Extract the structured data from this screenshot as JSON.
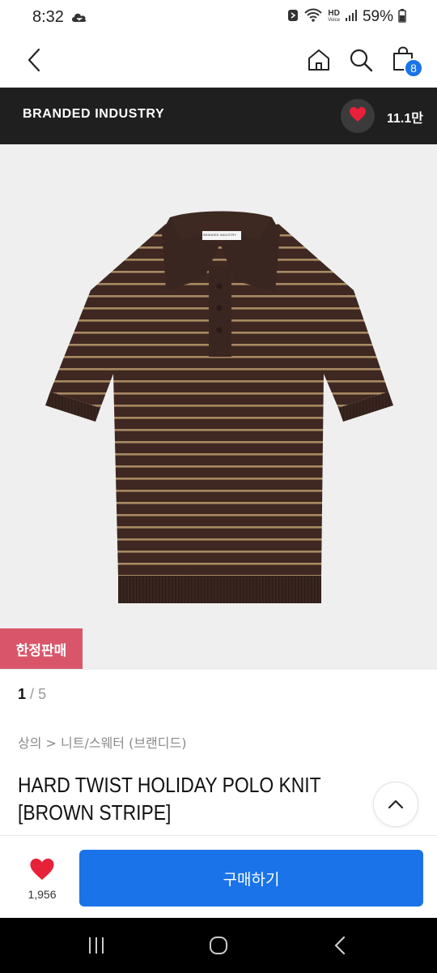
{
  "status_bar": {
    "time": "8:32",
    "battery_text": "59%",
    "hd_label_top": "HD",
    "hd_label_bottom": "Voice",
    "icons": [
      "cloud-icon",
      "nfc-icon",
      "wifi-icon",
      "hd-voice-icon",
      "signal-icon",
      "battery-icon"
    ]
  },
  "top_nav": {
    "icons": [
      "back-icon",
      "home-icon",
      "search-icon",
      "cart-icon"
    ],
    "cart_count": "8"
  },
  "brand": {
    "name": "BRANDED INDUSTRY",
    "like_count": "11.1만",
    "accent_color": "#e8213a"
  },
  "product": {
    "limited_badge": "한정판매",
    "limited_badge_color": "#d9566a",
    "image_index": "1",
    "image_separator": "/",
    "image_total": "5",
    "breadcrumb": "상의 > 니트/스웨터 (브랜디드)",
    "title_line1": "HARD TWIST HOLIDAY POLO KNIT",
    "title_line2": "[BROWN STRIPE]",
    "shirt_label": "BRANDED INDUSTRY"
  },
  "action_bar": {
    "like_count": "1,956",
    "buy_label": "구매하기",
    "buy_color": "#1a73e8"
  },
  "system_nav": {
    "icons": [
      "recents-icon",
      "home-circle-icon",
      "system-back-icon"
    ]
  }
}
